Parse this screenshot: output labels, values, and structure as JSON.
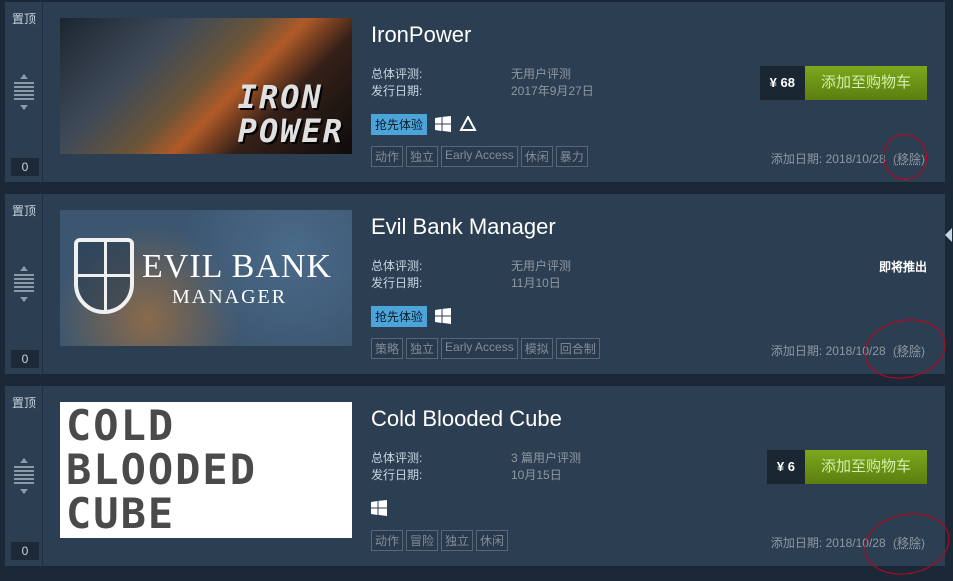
{
  "pin_label": "置顶",
  "labels": {
    "review": "总体评测:",
    "release": "发行日期:",
    "added": "添加日期:",
    "remove": "(移除)",
    "add_to_cart": "添加至购物车",
    "early_access": "抢先体验",
    "coming_soon": "即将推出"
  },
  "games": [
    {
      "title": "IronPower",
      "capsule_text": "IRON\nPOWER",
      "review": "无用户评测",
      "release_date": "2017年9月27日",
      "price": "¥ 68",
      "rank": "0",
      "early_access": true,
      "platforms": [
        "windows-icon",
        "vr-icon"
      ],
      "tags": [
        "动作",
        "独立",
        "Early Access",
        "休闲",
        "暴力"
      ],
      "added_date": "2018/10/28"
    },
    {
      "title": "Evil Bank Manager",
      "capsule_text_1": "EVIL BANK",
      "capsule_text_2": "MANAGER",
      "review": "无用户评测",
      "release_date": "11月10日",
      "rank": "0",
      "early_access": true,
      "platforms": [
        "windows-icon"
      ],
      "tags": [
        "策略",
        "独立",
        "Early Access",
        "模拟",
        "回合制"
      ],
      "added_date": "2018/10/28"
    },
    {
      "title": "Cold Blooded Cube",
      "capsule_text": "COLD\nBLOODED\nCUBE",
      "review": "3 篇用户评测",
      "release_date": "10月15日",
      "price": "¥ 6",
      "rank": "0",
      "early_access": false,
      "platforms": [
        "windows-icon"
      ],
      "tags": [
        "动作",
        "冒险",
        "独立",
        "休闲"
      ],
      "added_date": "2018/10/28"
    }
  ],
  "colors": {
    "background": "#1b2838",
    "row": "#2c3e52",
    "cart_button": "#6c9018",
    "early_access": "#4ba4da",
    "annotation": "#c8001a"
  }
}
